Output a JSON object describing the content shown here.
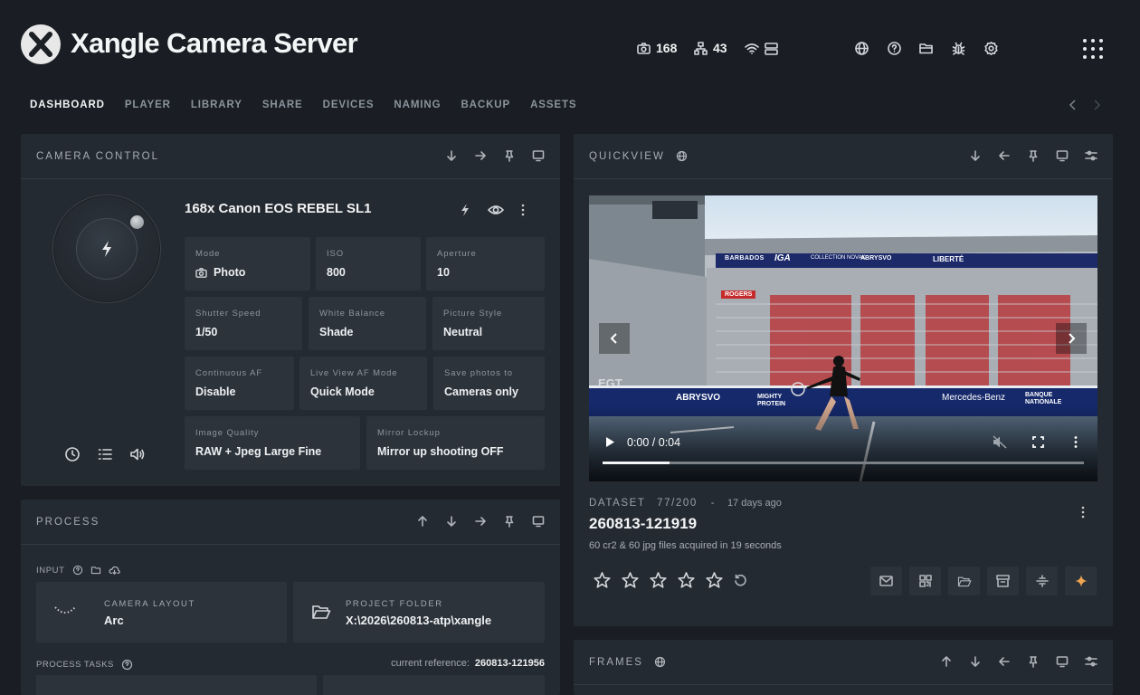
{
  "app": {
    "title": "Xangle Camera Server"
  },
  "header": {
    "stats": [
      {
        "icon": "camera-icon",
        "value": "168"
      },
      {
        "icon": "network-icon",
        "value": "43"
      }
    ]
  },
  "nav": {
    "tabs": [
      {
        "label": "DASHBOARD",
        "active": true
      },
      {
        "label": "PLAYER"
      },
      {
        "label": "LIBRARY"
      },
      {
        "label": "SHARE"
      },
      {
        "label": "DEVICES"
      },
      {
        "label": "NAMING"
      },
      {
        "label": "BACKUP"
      },
      {
        "label": "ASSETS"
      }
    ]
  },
  "camera_control": {
    "title": "CAMERA CONTROL",
    "camera_name": "168x Canon EOS REBEL SL1",
    "settings": {
      "mode": {
        "label": "Mode",
        "value": "Photo"
      },
      "iso": {
        "label": "ISO",
        "value": "800"
      },
      "aperture": {
        "label": "Aperture",
        "value": "10"
      },
      "shutter": {
        "label": "Shutter Speed",
        "value": "1/50"
      },
      "white_balance": {
        "label": "White Balance",
        "value": "Shade"
      },
      "picture_style": {
        "label": "Picture Style",
        "value": "Neutral"
      },
      "continuous_af": {
        "label": "Continuous AF",
        "value": "Disable"
      },
      "live_view_af": {
        "label": "Live View AF Mode",
        "value": "Quick Mode"
      },
      "save_photos": {
        "label": "Save photos to",
        "value": "Cameras only"
      },
      "image_quality": {
        "label": "Image Quality",
        "value": "RAW + Jpeg Large Fine"
      },
      "mirror_lockup": {
        "label": "Mirror Lockup",
        "value": "Mirror up shooting OFF"
      }
    }
  },
  "process": {
    "title": "PROCESS",
    "input_label": "INPUT",
    "camera_layout": {
      "label": "CAMERA LAYOUT",
      "value": "Arc"
    },
    "project_folder": {
      "label": "PROJECT FOLDER",
      "value": "X:\\2026\\260813-atp\\xangle"
    },
    "tasks_label": "PROCESS TASKS",
    "current_reference": {
      "label": "current reference:",
      "value": "260813-121956"
    }
  },
  "quickview": {
    "title": "QUICKVIEW",
    "video": {
      "time": "0:00 / 0:04",
      "progress": 0.14,
      "ad_boards": [
        "ABRYSVO",
        "MIGHTY PROTEIN",
        "Mercedes-Benz",
        "BANQUE NATIONALE"
      ],
      "top_banners": [
        "BARBADOS",
        "IGA",
        "COLLECTION NOVAK",
        "ABRYSVO",
        "LIBERTÉ"
      ],
      "side_banner": "ROGERS",
      "court_text": "EGT"
    },
    "dataset_label": "DATASET",
    "dataset_count": "77/200",
    "dataset_sep": "-",
    "dataset_ago": "17 days ago",
    "dataset_title": "260813-121919",
    "dataset_summary": "60 cr2 & 60 jpg files acquired in 19 seconds",
    "rating": 0,
    "rating_max": 5
  },
  "frames": {
    "title": "FRAMES"
  },
  "colors": {
    "background": "#1a1e24",
    "panel": "#242a31",
    "card": "#2c333b",
    "accent": "#f0a552"
  }
}
